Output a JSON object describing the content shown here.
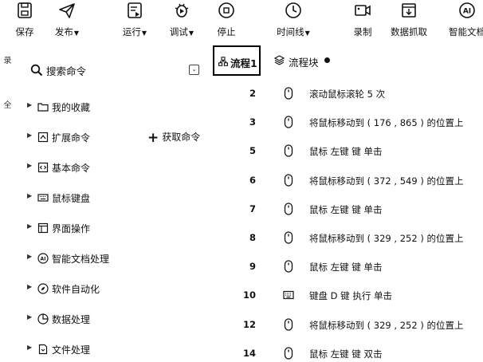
{
  "toolbar": {
    "save": "保存",
    "publish": "发布",
    "run": "运行",
    "debug": "调试",
    "stop": "停止",
    "timeline": "时间线",
    "record": "录制",
    "data_capture": "数据抓取",
    "smart_doc": "智能文档",
    "caret": "▼"
  },
  "left_strip": [
    "录",
    "全"
  ],
  "search": {
    "label": "搜索命令",
    "collapse": "⌄"
  },
  "fetch_command": "获取命令",
  "tree": [
    {
      "label": "我的收藏",
      "icon": "folder-icon"
    },
    {
      "label": "扩展命令",
      "icon": "extension-icon"
    },
    {
      "label": "基本命令",
      "icon": "code-icon"
    },
    {
      "label": "鼠标键盘",
      "icon": "keyboard-icon"
    },
    {
      "label": "界面操作",
      "icon": "window-icon"
    },
    {
      "label": "智能文档处理",
      "icon": "ai-icon"
    },
    {
      "label": "软件自动化",
      "icon": "compass-icon"
    },
    {
      "label": "数据处理",
      "icon": "pie-chart-icon"
    },
    {
      "label": "文件处理",
      "icon": "file-icon"
    }
  ],
  "tabs": {
    "flow1": "流程1",
    "flow_block": "流程块"
  },
  "steps": [
    {
      "num": "2",
      "text": "滚动鼠标滚轮 5 次",
      "icon": "mouse-icon"
    },
    {
      "num": "3",
      "text": "将鼠标移动到 ( 176 , 865 ) 的位置上",
      "icon": "mouse-icon"
    },
    {
      "num": "5",
      "text": "鼠标 左键 键 单击",
      "icon": "mouse-icon"
    },
    {
      "num": "6",
      "text": "将鼠标移动到 ( 372 , 549 ) 的位置上",
      "icon": "mouse-icon"
    },
    {
      "num": "7",
      "text": "鼠标 左键 键 单击",
      "icon": "mouse-icon"
    },
    {
      "num": "8",
      "text": "将鼠标移动到 ( 329 , 252 ) 的位置上",
      "icon": "mouse-icon"
    },
    {
      "num": "9",
      "text": "鼠标 左键 键 单击",
      "icon": "mouse-icon"
    },
    {
      "num": "10",
      "text": "键盘 D 键 执行 单击",
      "icon": "keyboard-icon"
    },
    {
      "num": "12",
      "text": "将鼠标移动到 ( 329 , 252 ) 的位置上",
      "icon": "mouse-icon"
    },
    {
      "num": "14",
      "text": "鼠标 左键 键 双击",
      "icon": "mouse-icon"
    }
  ]
}
